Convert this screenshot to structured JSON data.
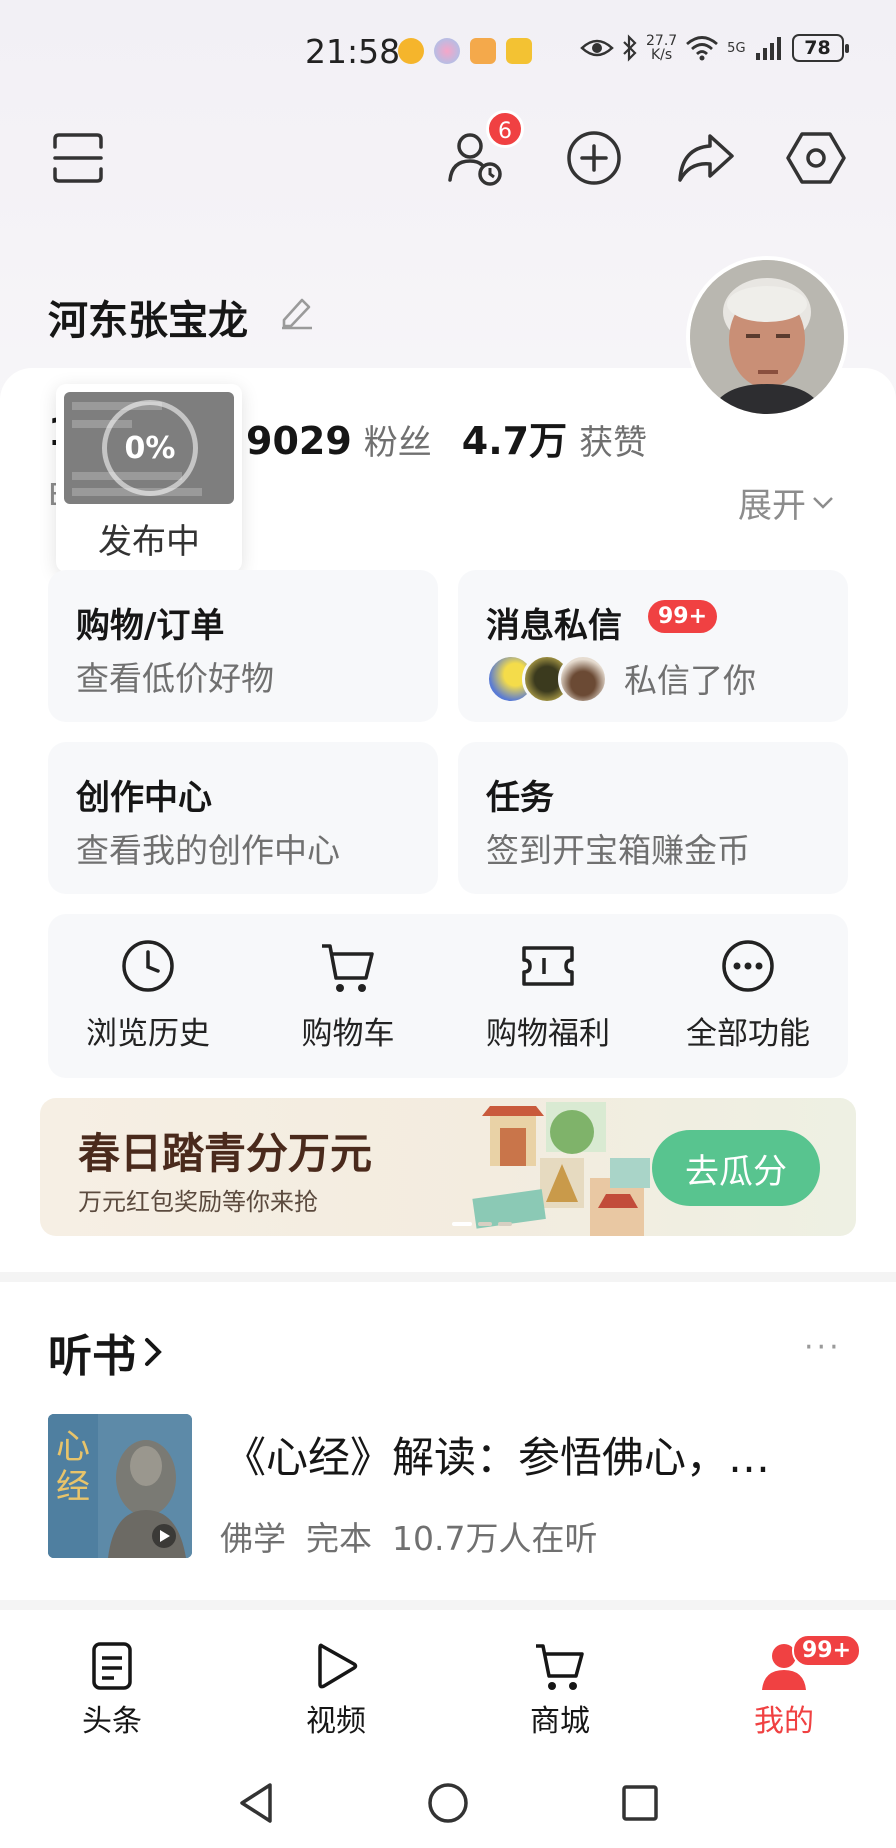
{
  "status_bar": {
    "time": "21:58",
    "net_speed_value": "27.7",
    "net_speed_unit": "K/s",
    "signal_label": "5G",
    "battery": "78"
  },
  "toolbar": {
    "friends_badge": "6"
  },
  "profile": {
    "username": "河东张宝龙",
    "fans_count": "9029",
    "fans_label": "粉丝",
    "likes_count": "4.7万",
    "likes_label": "获赞",
    "expand_label": "展开",
    "left_peek_num": "1",
    "left_peek_text": "E"
  },
  "publishing": {
    "progress": "0%",
    "label": "发布中"
  },
  "cards": {
    "shopping": {
      "title": "购物/订单",
      "subtitle": "查看低价好物"
    },
    "messages": {
      "title": "消息私信",
      "badge": "99+",
      "text": "私信了你"
    },
    "creator": {
      "title": "创作中心",
      "subtitle": "查看我的创作中心"
    },
    "tasks": {
      "title": "任务",
      "subtitle": "签到开宝箱赚金币"
    }
  },
  "tools": [
    {
      "label": "浏览历史",
      "icon": "clock-icon"
    },
    {
      "label": "购物车",
      "icon": "cart-icon"
    },
    {
      "label": "购物福利",
      "icon": "ticket-icon"
    },
    {
      "label": "全部功能",
      "icon": "more-circle-icon"
    }
  ],
  "banner": {
    "title": "春日踏青分万元",
    "subtitle": "万元红包奖励等你来抢",
    "button": "去瓜分"
  },
  "audiobook": {
    "section_title": "听书",
    "more": "···",
    "book_title": "《心经》解读：参悟佛心，…",
    "category": "佛学",
    "status": "完本",
    "listeners": "10.7万人在听"
  },
  "bottom_nav": [
    {
      "label": "头条",
      "icon": "news-icon"
    },
    {
      "label": "视频",
      "icon": "play-icon"
    },
    {
      "label": "商城",
      "icon": "cart-icon"
    },
    {
      "label": "我的",
      "icon": "user-icon",
      "badge": "99+"
    }
  ],
  "colors": {
    "accent_red": "#f04142",
    "banner_button": "#58c48f"
  }
}
